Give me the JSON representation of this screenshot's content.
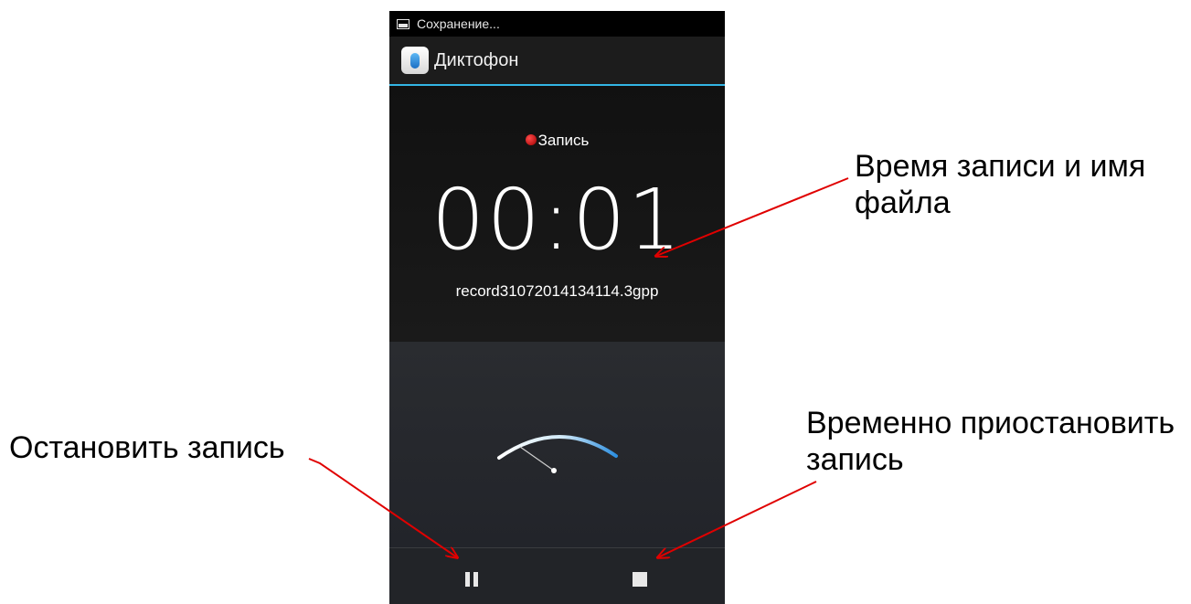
{
  "status_bar": {
    "notification_icon": "image-icon",
    "text": "Сохранение..."
  },
  "action_bar": {
    "app_icon": "microphone-icon",
    "title": "Диктофон",
    "accent_color": "#33b5e5"
  },
  "recording": {
    "state_label": "Запись",
    "state_color": "#cc0000",
    "elapsed": "00:01",
    "filename": "record31072014134114.3gpp"
  },
  "level_gauge": {
    "icon": "volume-level-gauge"
  },
  "controls": {
    "pause": {
      "icon": "pause-icon"
    },
    "stop": {
      "icon": "stop-icon"
    }
  },
  "annotations": {
    "time_and_file": "Время записи и имя файла",
    "stop_recording": "Остановить запись",
    "pause_recording": "Временно приостановить запись",
    "arrow_color": "#e00000"
  }
}
